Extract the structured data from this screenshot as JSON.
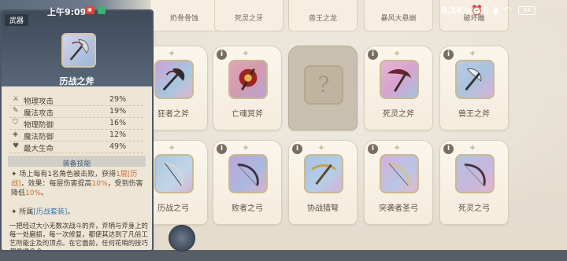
{
  "status_bar": {
    "time": "上午9:09",
    "network_speed": "0.1K/s",
    "battery": "44"
  },
  "top_row": [
    "奶骨骨蚀",
    "死灵之牙",
    "兽王之龙",
    "暴风大悬崩",
    "破坏雕"
  ],
  "grid": [
    {
      "name": "狂者之斧",
      "info": "i",
      "locked": false
    },
    {
      "name": "亡魂冥斧",
      "info": "i",
      "locked": false
    },
    {
      "name": "?",
      "info": "",
      "locked": true
    },
    {
      "name": "死灵之斧",
      "info": "i",
      "locked": false
    },
    {
      "name": "兽王之斧",
      "info": "i",
      "locked": false
    },
    {
      "name": "历战之弓",
      "info": "i",
      "locked": false
    },
    {
      "name": "败者之弓",
      "info": "i",
      "locked": false
    },
    {
      "name": "协战猎弩",
      "info": "i",
      "locked": false
    },
    {
      "name": "突袭者圣弓",
      "info": "i",
      "locked": false
    },
    {
      "name": "死灵之弓",
      "info": "i",
      "locked": false
    }
  ],
  "panel": {
    "tag": "武器",
    "weapon_name": "历战之斧",
    "stats": [
      {
        "icon": "sword-icon",
        "label": "物理攻击",
        "value": "29%"
      },
      {
        "icon": "wand-icon",
        "label": "魔法攻击",
        "value": "19%"
      },
      {
        "icon": "shield-icon",
        "label": "物理防御",
        "value": "16%"
      },
      {
        "icon": "magic-shield-icon",
        "label": "魔法防御",
        "value": "12%"
      },
      {
        "icon": "heart-icon",
        "label": "最大生命",
        "value": "49%"
      }
    ],
    "skill_title": "装备技能",
    "skill_line1_a": "场上每有1名角色被击败，获得",
    "skill_line1_b": "1层[历战]",
    "skill_line1_c": "，效果：每层伤害提高",
    "skill_line1_d": "10%",
    "skill_line1_e": "，受到伤害降低",
    "skill_line1_f": "10%",
    "skill_line1_g": "。",
    "owned_prefix": "所属",
    "owned_link": "[历战套装]",
    "owned_suffix": "。",
    "lore": "一把经过大小无数次战斗的斧，斧柄与斧身上的每一处磨损，每一次修复，都使其达到了凡俗工艺所能企及的顶点。在它面前，任何花哨的技巧都显得多余。"
  },
  "colors": {
    "panel_header": "#3f4a5a",
    "highlight": "#d06a2c",
    "link": "#3e7cb5",
    "card_bg": "#f6efe1"
  }
}
